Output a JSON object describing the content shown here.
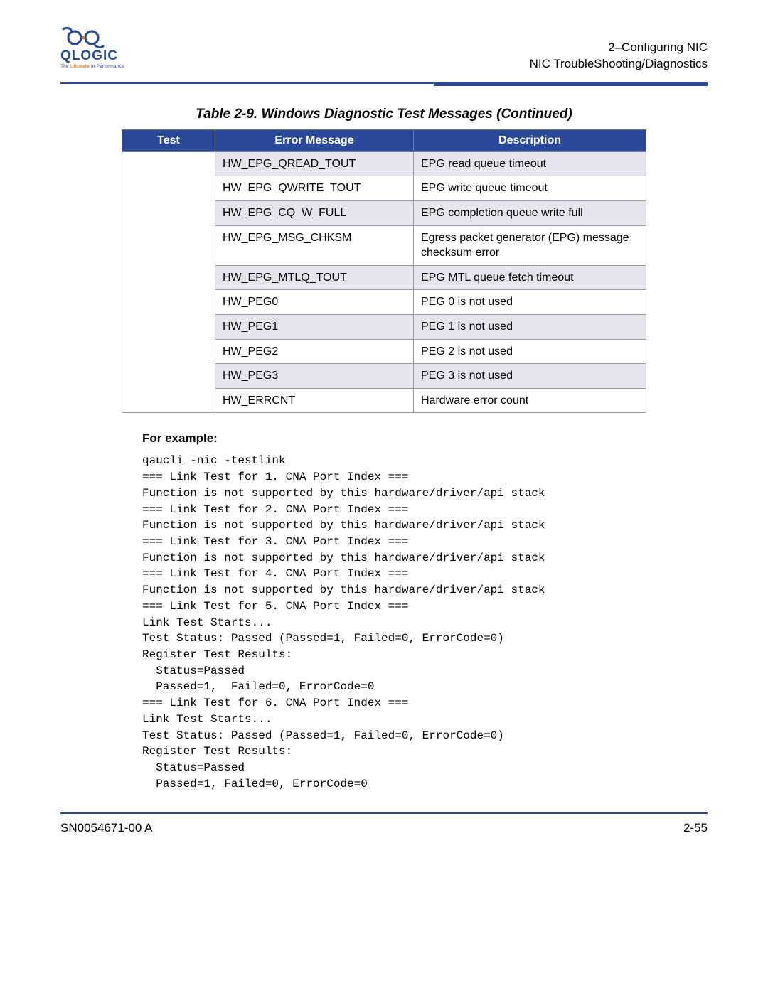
{
  "header": {
    "logo_name": "QLOGIC",
    "logo_tagline_prefix": "The ",
    "logo_tagline_highlight": "Ultimate",
    "logo_tagline_suffix": " in Performance",
    "right_line1": "2–Configuring NIC",
    "right_line2": "NIC TroubleShooting/Diagnostics"
  },
  "table": {
    "caption": "Table 2-9. Windows Diagnostic Test Messages  (Continued)",
    "headers": {
      "test": "Test",
      "error": "Error Message",
      "desc": "Description"
    },
    "rows": [
      {
        "msg": "HW_EPG_QREAD_TOUT",
        "desc": "EPG read queue timeout"
      },
      {
        "msg": "HW_EPG_QWRITE_TOUT",
        "desc": "EPG write queue timeout"
      },
      {
        "msg": "HW_EPG_CQ_W_FULL",
        "desc": "EPG completion queue write full"
      },
      {
        "msg": "HW_EPG_MSG_CHKSM",
        "desc": "Egress packet generator (EPG) message checksum error"
      },
      {
        "msg": "HW_EPG_MTLQ_TOUT",
        "desc": "EPG MTL queue fetch timeout"
      },
      {
        "msg": "HW_PEG0",
        "desc": "PEG 0 is not used"
      },
      {
        "msg": "HW_PEG1",
        "desc": "PEG 1 is not used"
      },
      {
        "msg": "HW_PEG2",
        "desc": "PEG 2 is not used"
      },
      {
        "msg": "HW_PEG3",
        "desc": "PEG 3 is not used"
      },
      {
        "msg": "HW_ERRCNT",
        "desc": "Hardware error count"
      }
    ]
  },
  "example": {
    "label": "For example:",
    "text": "qaucli -nic -testlink\n=== Link Test for 1. CNA Port Index ===\nFunction is not supported by this hardware/driver/api stack\n=== Link Test for 2. CNA Port Index ===\nFunction is not supported by this hardware/driver/api stack\n=== Link Test for 3. CNA Port Index ===\nFunction is not supported by this hardware/driver/api stack\n=== Link Test for 4. CNA Port Index ===\nFunction is not supported by this hardware/driver/api stack\n=== Link Test for 5. CNA Port Index ===\nLink Test Starts...\nTest Status: Passed (Passed=1, Failed=0, ErrorCode=0)\nRegister Test Results:\n  Status=Passed\n  Passed=1,  Failed=0, ErrorCode=0\n=== Link Test for 6. CNA Port Index ===\nLink Test Starts...\nTest Status: Passed (Passed=1, Failed=0, ErrorCode=0)\nRegister Test Results:\n  Status=Passed\n  Passed=1, Failed=0, ErrorCode=0"
  },
  "footer": {
    "left": "SN0054671-00 A",
    "right": "2-55"
  }
}
